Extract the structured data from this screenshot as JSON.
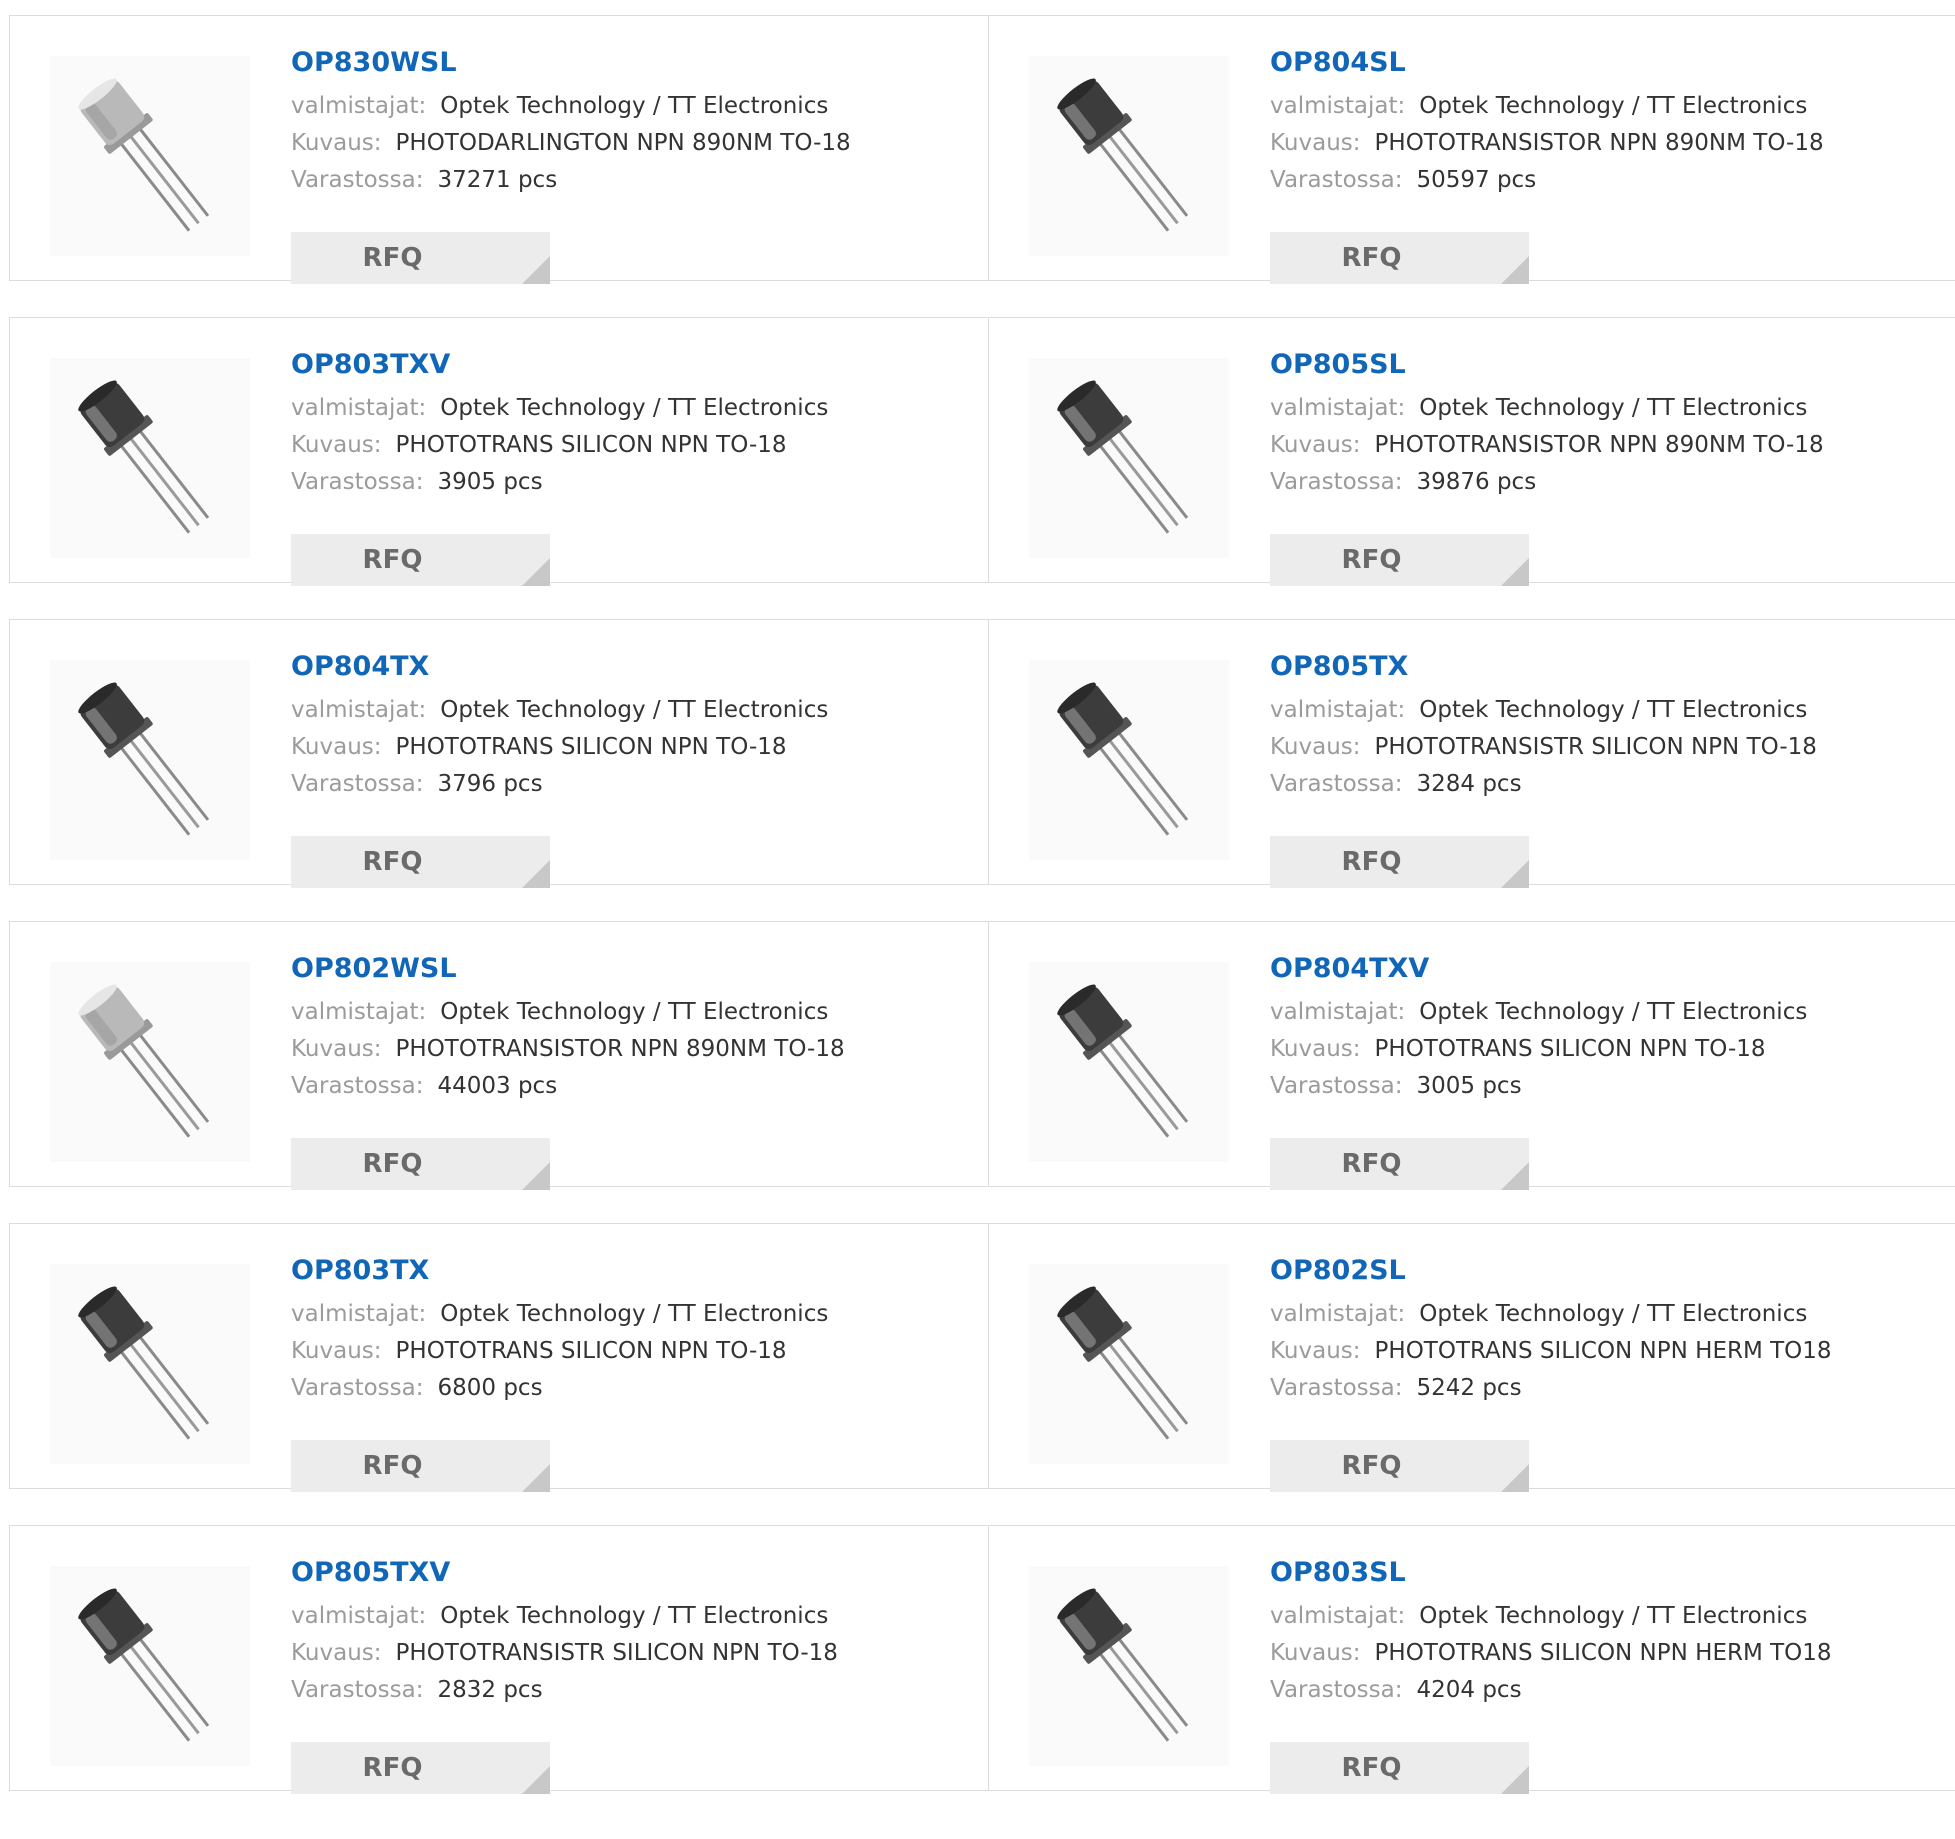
{
  "labels": {
    "manufacturer": "valmistajat:",
    "description": "Kuvaus:",
    "stock": "Varastossa:",
    "rfq": "RFQ"
  },
  "colors": {
    "part_link": "#1166b8",
    "label": "#9b9b9b",
    "value": "#333333",
    "rfq_bg": "#ececec"
  },
  "products": [
    {
      "part": "OP830WSL",
      "manufacturer": "Optek Technology / TT Electronics",
      "description": "PHOTODARLINGTON NPN 890NM TO-18",
      "stock": "37271 pcs",
      "image": "to18-clear-lens-transistor"
    },
    {
      "part": "OP804SL",
      "manufacturer": "Optek Technology / TT Electronics",
      "description": "PHOTOTRANSISTOR NPN 890NM TO-18",
      "stock": "50597 pcs",
      "image": "to18-dark-transistor"
    },
    {
      "part": "OP803TXV",
      "manufacturer": "Optek Technology / TT Electronics",
      "description": "PHOTOTRANS SILICON NPN TO-18",
      "stock": "3905 pcs",
      "image": "to18-dark-transistor"
    },
    {
      "part": "OP805SL",
      "manufacturer": "Optek Technology / TT Electronics",
      "description": "PHOTOTRANSISTOR NPN 890NM TO-18",
      "stock": "39876 pcs",
      "image": "to18-dark-transistor"
    },
    {
      "part": "OP804TX",
      "manufacturer": "Optek Technology / TT Electronics",
      "description": "PHOTOTRANS SILICON NPN TO-18",
      "stock": "3796 pcs",
      "image": "to18-dark-transistor"
    },
    {
      "part": "OP805TX",
      "manufacturer": "Optek Technology / TT Electronics",
      "description": "PHOTOTRANSISTR SILICON NPN TO-18",
      "stock": "3284 pcs",
      "image": "to18-dark-transistor"
    },
    {
      "part": "OP802WSL",
      "manufacturer": "Optek Technology / TT Electronics",
      "description": "PHOTOTRANSISTOR NPN 890NM TO-18",
      "stock": "44003 pcs",
      "image": "to18-clear-lens-transistor"
    },
    {
      "part": "OP804TXV",
      "manufacturer": "Optek Technology / TT Electronics",
      "description": "PHOTOTRANS SILICON NPN TO-18",
      "stock": "3005 pcs",
      "image": "to18-dark-transistor"
    },
    {
      "part": "OP803TX",
      "manufacturer": "Optek Technology / TT Electronics",
      "description": "PHOTOTRANS SILICON NPN TO-18",
      "stock": "6800 pcs",
      "image": "to18-dark-transistor"
    },
    {
      "part": "OP802SL",
      "manufacturer": "Optek Technology / TT Electronics",
      "description": "PHOTOTRANS SILICON NPN HERM TO18",
      "stock": "5242 pcs",
      "image": "to18-dark-transistor"
    },
    {
      "part": "OP805TXV",
      "manufacturer": "Optek Technology / TT Electronics",
      "description": "PHOTOTRANSISTR SILICON NPN TO-18",
      "stock": "2832 pcs",
      "image": "to18-dark-transistor"
    },
    {
      "part": "OP803SL",
      "manufacturer": "Optek Technology / TT Electronics",
      "description": "PHOTOTRANS SILICON NPN HERM TO18",
      "stock": "4204 pcs",
      "image": "to18-dark-transistor"
    }
  ]
}
